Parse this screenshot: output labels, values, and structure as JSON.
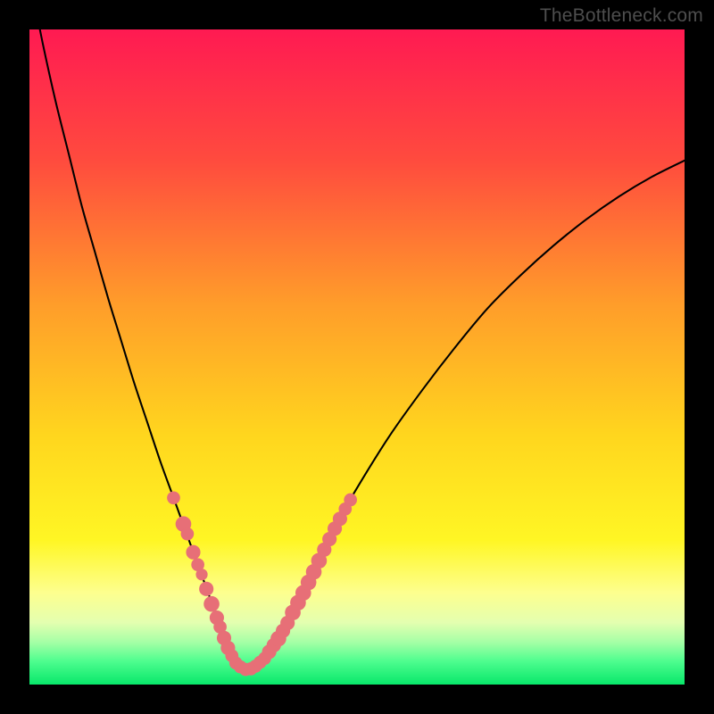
{
  "watermark": "TheBottleneck.com",
  "colors": {
    "frame": "#000000",
    "watermark": "#4e4e4e",
    "curve": "#000000",
    "marker": "#e76f77"
  },
  "chart_data": {
    "type": "line",
    "title": "",
    "xlabel": "",
    "ylabel": "",
    "xlim": [
      0,
      100
    ],
    "ylim": [
      0,
      100
    ],
    "annotations": [],
    "gradient_stops": [
      {
        "offset": 0.0,
        "color": "#ff1a52"
      },
      {
        "offset": 0.2,
        "color": "#ff4b3e"
      },
      {
        "offset": 0.42,
        "color": "#ff9d2a"
      },
      {
        "offset": 0.62,
        "color": "#ffd61e"
      },
      {
        "offset": 0.78,
        "color": "#fff624"
      },
      {
        "offset": 0.86,
        "color": "#fdff8f"
      },
      {
        "offset": 0.905,
        "color": "#e4ffb0"
      },
      {
        "offset": 0.935,
        "color": "#a6ffa6"
      },
      {
        "offset": 0.965,
        "color": "#4dfd8e"
      },
      {
        "offset": 1.0,
        "color": "#08e76a"
      }
    ],
    "series": [
      {
        "name": "bottleneck-curve",
        "x": [
          0,
          2,
          4,
          6,
          8,
          10,
          12,
          14,
          16,
          18,
          20,
          22,
          24,
          26,
          28,
          29,
          30,
          31,
          32,
          33,
          34,
          36,
          38,
          40,
          43,
          46,
          50,
          55,
          60,
          65,
          70,
          75,
          80,
          85,
          90,
          95,
          100
        ],
        "y": [
          108,
          98,
          89,
          81,
          73,
          66,
          59,
          52.5,
          46,
          40,
          34,
          28.5,
          23,
          17.5,
          12,
          9,
          6.5,
          4.5,
          3,
          2.3,
          2.5,
          4,
          7,
          11,
          17,
          23,
          30,
          38,
          45,
          51.5,
          57.5,
          62.5,
          67,
          71,
          74.5,
          77.5,
          80
        ]
      }
    ],
    "marker_clusters": [
      {
        "name": "left-cluster",
        "points": [
          {
            "x": 22.0,
            "y": 28.5,
            "r": 1.0
          },
          {
            "x": 23.5,
            "y": 24.5,
            "r": 1.2
          },
          {
            "x": 24.1,
            "y": 23.0,
            "r": 1.0
          },
          {
            "x": 25.0,
            "y": 20.2,
            "r": 1.1
          },
          {
            "x": 25.7,
            "y": 18.3,
            "r": 1.0
          },
          {
            "x": 26.3,
            "y": 16.8,
            "r": 0.9
          },
          {
            "x": 27.0,
            "y": 14.6,
            "r": 1.1
          },
          {
            "x": 27.8,
            "y": 12.3,
            "r": 1.2
          },
          {
            "x": 28.6,
            "y": 10.2,
            "r": 1.1
          },
          {
            "x": 29.1,
            "y": 8.8,
            "r": 1.0
          },
          {
            "x": 29.7,
            "y": 7.1,
            "r": 1.1
          },
          {
            "x": 30.3,
            "y": 5.6,
            "r": 1.1
          },
          {
            "x": 30.9,
            "y": 4.4,
            "r": 1.0
          }
        ]
      },
      {
        "name": "trough-cluster",
        "points": [
          {
            "x": 31.5,
            "y": 3.3,
            "r": 1.0
          },
          {
            "x": 32.2,
            "y": 2.7,
            "r": 1.0
          },
          {
            "x": 33.0,
            "y": 2.3,
            "r": 1.0
          },
          {
            "x": 33.8,
            "y": 2.4,
            "r": 1.0
          },
          {
            "x": 34.5,
            "y": 2.8,
            "r": 1.0
          },
          {
            "x": 35.2,
            "y": 3.4,
            "r": 1.0
          }
        ]
      },
      {
        "name": "right-cluster",
        "points": [
          {
            "x": 35.9,
            "y": 4.0,
            "r": 1.0
          },
          {
            "x": 36.6,
            "y": 5.0,
            "r": 1.1
          },
          {
            "x": 37.3,
            "y": 6.0,
            "r": 1.1
          },
          {
            "x": 38.0,
            "y": 7.0,
            "r": 1.2
          },
          {
            "x": 38.7,
            "y": 8.2,
            "r": 1.1
          },
          {
            "x": 39.4,
            "y": 9.4,
            "r": 1.1
          },
          {
            "x": 40.2,
            "y": 11.0,
            "r": 1.2
          },
          {
            "x": 41.0,
            "y": 12.5,
            "r": 1.2
          },
          {
            "x": 41.8,
            "y": 14.0,
            "r": 1.2
          },
          {
            "x": 42.6,
            "y": 15.6,
            "r": 1.2
          },
          {
            "x": 43.4,
            "y": 17.2,
            "r": 1.2
          },
          {
            "x": 44.2,
            "y": 18.9,
            "r": 1.2
          },
          {
            "x": 45.0,
            "y": 20.6,
            "r": 1.1
          },
          {
            "x": 45.8,
            "y": 22.2,
            "r": 1.1
          },
          {
            "x": 46.6,
            "y": 23.8,
            "r": 1.1
          },
          {
            "x": 47.4,
            "y": 25.3,
            "r": 1.1
          },
          {
            "x": 48.2,
            "y": 26.8,
            "r": 1.0
          },
          {
            "x": 49.0,
            "y": 28.2,
            "r": 1.0
          }
        ]
      }
    ]
  }
}
